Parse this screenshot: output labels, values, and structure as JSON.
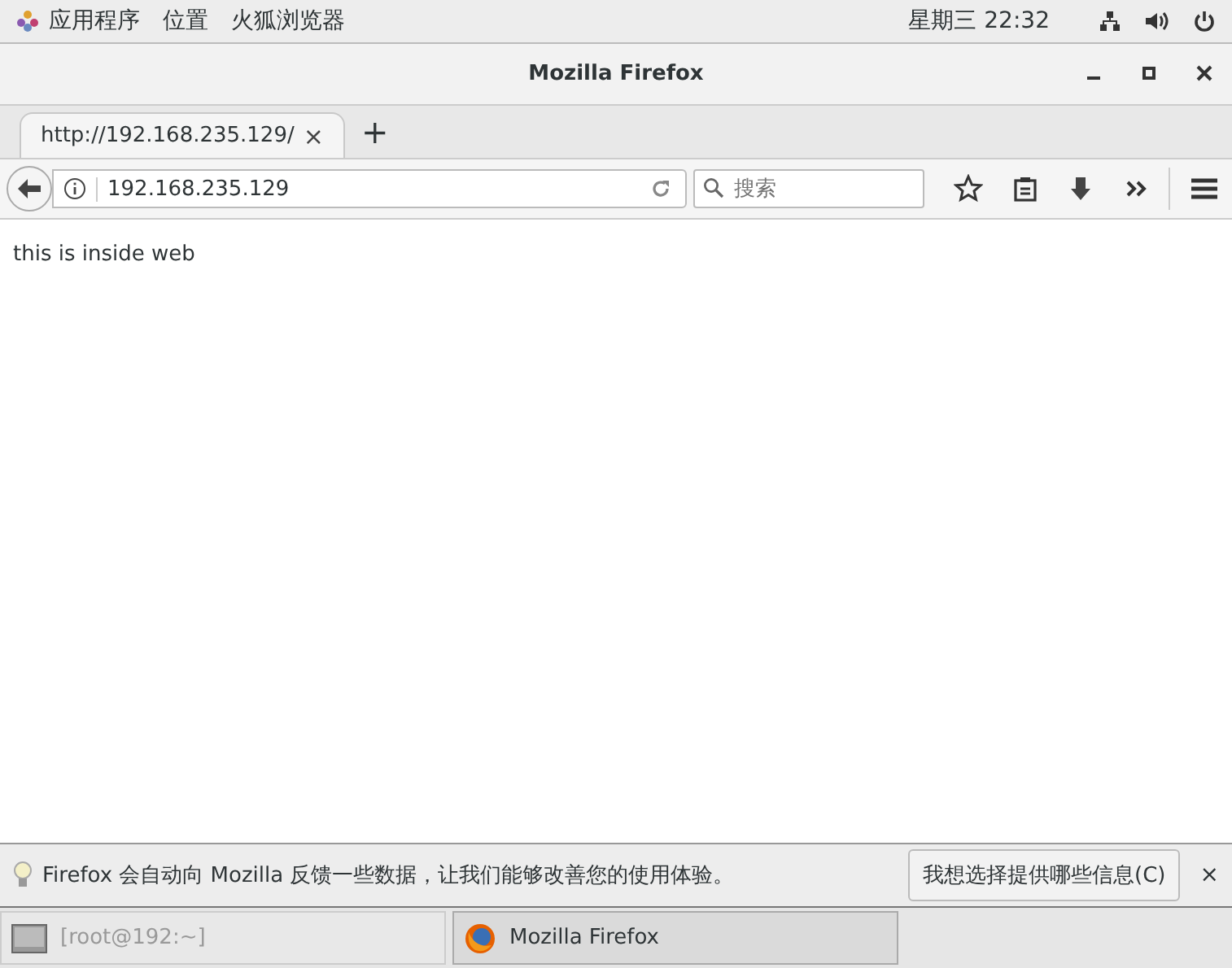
{
  "top_bar": {
    "menus": [
      "应用程序",
      "位置",
      "火狐浏览器"
    ],
    "clock": "星期三 22:32"
  },
  "window": {
    "title": "Mozilla Firefox"
  },
  "tabs": [
    {
      "label": "http://192.168.235.129/",
      "selected": true,
      "close": "×"
    }
  ],
  "new_tab": "+",
  "address_bar": {
    "value": "192.168.235.129"
  },
  "search": {
    "placeholder": "搜索"
  },
  "content": {
    "text": "this  is  inside  web"
  },
  "notification": {
    "message": "Firefox 会自动向 Mozilla 反馈一些数据，让我们能够改善您的使用体验。",
    "button": "我想选择提供哪些信息(C)",
    "close": "×"
  },
  "taskbar": [
    {
      "label": "[root@192:~]",
      "kind": "terminal",
      "selected": false
    },
    {
      "label": "Mozilla Firefox",
      "kind": "firefox",
      "selected": true
    }
  ]
}
